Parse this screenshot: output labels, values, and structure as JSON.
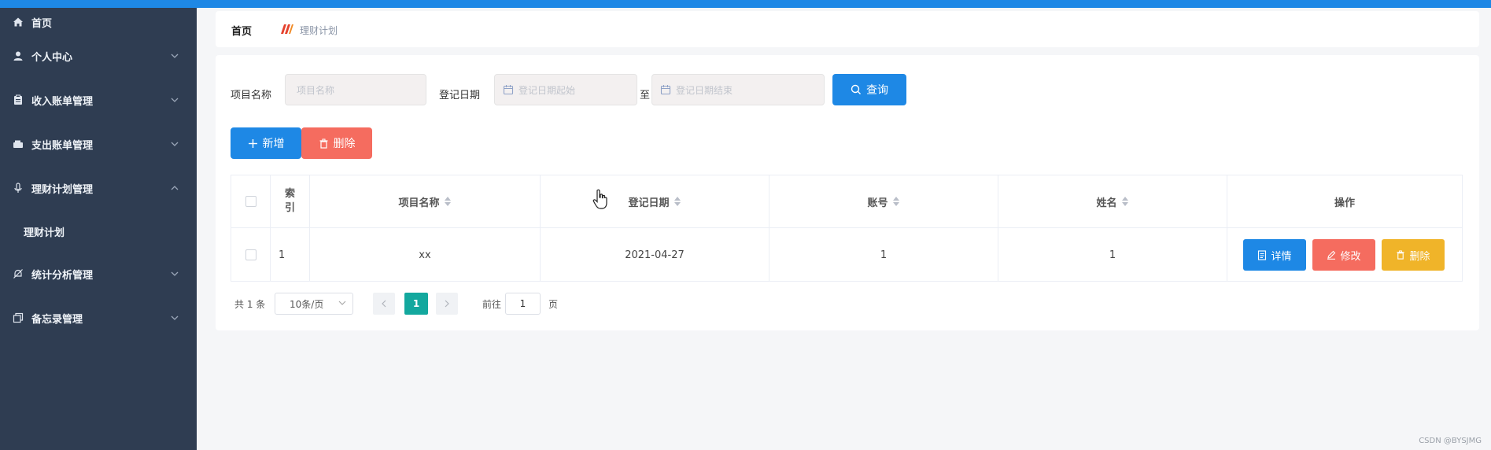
{
  "sidebar": {
    "items": [
      {
        "label": "首页",
        "icon": "home-icon"
      },
      {
        "label": "个人中心",
        "icon": "user-icon"
      },
      {
        "label": "收入账单管理",
        "icon": "clipboard-icon"
      },
      {
        "label": "支出账单管理",
        "icon": "wallet-icon"
      },
      {
        "label": "理财计划管理",
        "icon": "microphone-icon"
      },
      {
        "label": "理财计划",
        "icon": ""
      },
      {
        "label": "统计分析管理",
        "icon": "bell-off-icon"
      },
      {
        "label": "备忘录管理",
        "icon": "copy-icon"
      }
    ]
  },
  "breadcrumb": {
    "home": "首页",
    "current": "理财计划"
  },
  "search": {
    "name_label": "项目名称",
    "name_placeholder": "项目名称",
    "date_label": "登记日期",
    "date_start_placeholder": "登记日期起始",
    "date_to": "至",
    "date_end_placeholder": "登记日期结束",
    "query_button": "查询"
  },
  "actions": {
    "add": "新增",
    "delete": "删除"
  },
  "table": {
    "headers": [
      "索引",
      "项目名称",
      "登记日期",
      "账号",
      "姓名",
      "操作"
    ],
    "index_header_line1": "索",
    "index_header_line2": "引",
    "rows": [
      {
        "index": "1",
        "name": "xx",
        "date": "2021-04-27",
        "account": "1",
        "person": "1"
      }
    ],
    "ops": {
      "detail": "详情",
      "edit": "修改",
      "delete": "删除"
    }
  },
  "pagination": {
    "total": "共 1 条",
    "page_size": "10条/页",
    "current_page": "1",
    "goto_label": "前往",
    "goto_value": "1",
    "page_suffix": "页"
  },
  "watermark": "CSDN @BYSJMG",
  "colors": {
    "sidebar_bg": "#2f3d52",
    "primary": "#1e88e5",
    "danger": "#f56c5f",
    "warning": "#f0b429",
    "page_active": "#13a89e"
  }
}
